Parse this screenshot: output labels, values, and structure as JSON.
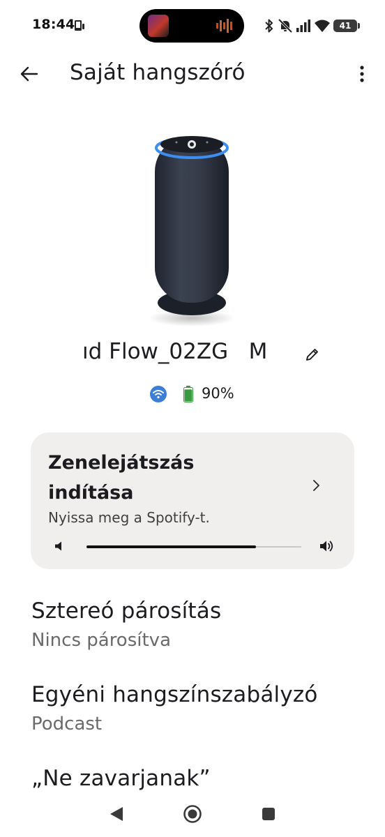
{
  "status_bar": {
    "time": "18:44",
    "battery_level": "41",
    "icons": [
      "phone-icon",
      "bluetooth-icon",
      "mute-icon",
      "signal-icon",
      "wifi-icon",
      "battery-icon"
    ]
  },
  "app_bar": {
    "title": "Saját hangszóró",
    "back_icon": "arrow-left-icon",
    "menu_icon": "more-vert-icon"
  },
  "device": {
    "name": "ıd Flow_02ZG   M",
    "battery_percent": "90%",
    "battery_fraction": 0.9,
    "connection": "wifi"
  },
  "music_card": {
    "title": "Zenelejátszás indítása",
    "subtitle": "Nyissa meg a Spotify-t.",
    "volume": 0.79
  },
  "settings": {
    "stereo": {
      "title": "Sztereó párosítás",
      "value": "Nincs párosítva"
    },
    "eq": {
      "title": "Egyéni hangszínszabályzó",
      "value": "Podcast"
    },
    "dnd": {
      "title": "„Ne zavarjanak”"
    }
  },
  "nav_bar": {
    "icons": [
      "nav-back-icon",
      "nav-home-icon",
      "nav-recents-icon"
    ]
  },
  "colors": {
    "card_background": "#f0efed",
    "accent_blue": "#3b7fd6",
    "battery_green": "#3a9a3f",
    "secondary_text": "#6a6a6a"
  }
}
